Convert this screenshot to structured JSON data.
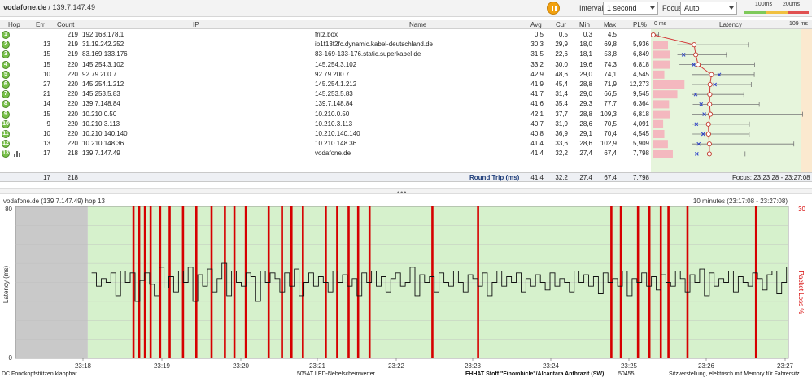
{
  "window": {
    "host": "vodafone.de",
    "ip_suffix": " / 139.7.147.49"
  },
  "toolbar": {
    "interval_label": "Interval",
    "interval_value": "1 second",
    "focus_label": "Focus",
    "focus_value": "Auto",
    "scale_100": "100ms",
    "scale_200": "200ms",
    "scale_colors": [
      "#7ec95a",
      "#f0c040",
      "#e05050"
    ]
  },
  "table": {
    "headers": {
      "hop": "Hop",
      "err": "Err",
      "count": "Count",
      "ip": "IP",
      "name": "Name",
      "avg": "Avg",
      "cur": "Cur",
      "min": "Min",
      "max": "Max",
      "pl": "PL%",
      "latency": "Latency",
      "lat_min": "0 ms",
      "lat_max": "109 ms"
    },
    "rows": [
      {
        "hop": "1",
        "err": "",
        "count": "219",
        "ip": "192.168.178.1",
        "name": "fritz.box",
        "avg": "0,5",
        "cur": "0,5",
        "min": "0,3",
        "max": "4,5",
        "pl": ""
      },
      {
        "hop": "2",
        "err": "13",
        "count": "219",
        "ip": "31.19.242.252",
        "name": "ip1f13f2fc.dynamic.kabel-deutschland.de",
        "avg": "30,3",
        "cur": "29,9",
        "min": "18,0",
        "max": "69,8",
        "pl": "5,936"
      },
      {
        "hop": "3",
        "err": "15",
        "count": "219",
        "ip": "83.169.133.176",
        "name": "83-169-133-176.static.superkabel.de",
        "avg": "31,5",
        "cur": "22,6",
        "min": "18,1",
        "max": "53,8",
        "pl": "6,849"
      },
      {
        "hop": "4",
        "err": "15",
        "count": "220",
        "ip": "145.254.3.102",
        "name": "145.254.3.102",
        "avg": "33,2",
        "cur": "30,0",
        "min": "19,6",
        "max": "74,3",
        "pl": "6,818"
      },
      {
        "hop": "5",
        "err": "10",
        "count": "220",
        "ip": "92.79.200.7",
        "name": "92.79.200.7",
        "avg": "42,9",
        "cur": "48,6",
        "min": "29,0",
        "max": "74,1",
        "pl": "4,545"
      },
      {
        "hop": "6",
        "err": "27",
        "count": "220",
        "ip": "145.254.1.212",
        "name": "145.254.1.212",
        "avg": "41,9",
        "cur": "45,4",
        "min": "28,8",
        "max": "71,9",
        "pl": "12,273"
      },
      {
        "hop": "7",
        "err": "21",
        "count": "220",
        "ip": "145.253.5.83",
        "name": "145.253.5.83",
        "avg": "41,7",
        "cur": "31,4",
        "min": "29,0",
        "max": "66,5",
        "pl": "9,545"
      },
      {
        "hop": "8",
        "err": "14",
        "count": "220",
        "ip": "139.7.148.84",
        "name": "139.7.148.84",
        "avg": "41,6",
        "cur": "35,4",
        "min": "29,3",
        "max": "77,7",
        "pl": "6,364"
      },
      {
        "hop": "9",
        "err": "15",
        "count": "220",
        "ip": "10.210.0.50",
        "name": "10.210.0.50",
        "avg": "42,1",
        "cur": "37,7",
        "min": "28,8",
        "max": "109,3",
        "pl": "6,818"
      },
      {
        "hop": "10",
        "err": "9",
        "count": "220",
        "ip": "10.210.3.113",
        "name": "10.210.3.113",
        "avg": "40,7",
        "cur": "31,9",
        "min": "28,6",
        "max": "70,5",
        "pl": "4,091"
      },
      {
        "hop": "11",
        "err": "10",
        "count": "220",
        "ip": "10.210.140.140",
        "name": "10.210.140.140",
        "avg": "40,8",
        "cur": "36,9",
        "min": "29,1",
        "max": "70,4",
        "pl": "4,545"
      },
      {
        "hop": "12",
        "err": "13",
        "count": "220",
        "ip": "10.210.148.36",
        "name": "10.210.148.36",
        "avg": "41,4",
        "cur": "33,6",
        "min": "28,6",
        "max": "102,9",
        "pl": "5,909"
      },
      {
        "hop": "13",
        "err": "17",
        "count": "218",
        "ip": "139.7.147.49",
        "name": "vodafone.de",
        "avg": "41,4",
        "cur": "32,2",
        "min": "27,4",
        "max": "67,4",
        "pl": "7,798"
      }
    ],
    "summary": {
      "err": "17",
      "count": "218",
      "label": "Round Trip (ms)",
      "avg": "41,4",
      "cur": "32,2",
      "min": "27,4",
      "max": "67,4",
      "pl": "7,798",
      "focus": "Focus: 23:23:28 - 23:27:08"
    }
  },
  "chart": {
    "title": "vodafone.de (139.7.147.49) hop 13",
    "range": "10 minutes (23:17:08 - 23:27:08)",
    "ylabel": "Latency (ms)",
    "y2label": "Packet Loss %",
    "y_ticks": [
      "0",
      "80"
    ],
    "y2_ticks": [
      "30"
    ],
    "x_ticks": [
      "23:18",
      "23:19",
      "23:20",
      "23:21",
      "23:22",
      "23:23",
      "23:24",
      "23:25",
      "23:26",
      "23:27"
    ],
    "colors": {
      "bg_gray": "#c9c9c9",
      "bg_green": "#d6f1cc",
      "loss": "#d60000",
      "line": "#111111"
    }
  },
  "chart_data": {
    "type": "line",
    "xlabel": "",
    "ylabel": "Latency (ms)",
    "ylim": [
      0,
      80
    ],
    "loss_marks_minutes": [
      23.79,
      23.82,
      23.85,
      23.88,
      23.93,
      23.98,
      24.05,
      24.12,
      24.2,
      24.27,
      24.32,
      24.38,
      24.5,
      24.57,
      24.62,
      24.68,
      24.8,
      24.86,
      24.92,
      24.97,
      25.03,
      25.36,
      25.6,
      26.3,
      26.35,
      26.44,
      26.5,
      26.56,
      26.6,
      26.7,
      27.06
    ],
    "latency_ms": [
      45,
      38,
      42,
      40,
      45,
      33,
      46,
      40,
      45,
      30,
      41,
      45,
      39,
      33,
      48,
      37,
      43,
      35,
      46,
      40,
      48,
      30,
      44,
      38,
      47,
      35,
      42,
      50,
      33,
      46,
      40,
      38,
      45,
      43,
      30,
      46,
      40,
      45,
      42,
      35,
      45,
      38,
      47,
      33,
      40,
      45,
      38,
      43,
      40,
      35,
      46,
      40,
      44,
      38,
      42,
      33,
      45,
      40,
      46,
      38,
      43,
      35,
      42,
      45,
      38,
      40,
      48,
      33,
      44,
      40,
      43,
      35,
      45,
      40,
      38,
      46,
      40,
      35,
      44,
      42,
      38,
      45,
      33,
      40,
      46,
      38,
      43,
      40,
      45,
      35,
      42,
      38,
      44,
      40,
      36,
      45,
      38,
      42,
      40,
      35,
      46,
      40,
      44,
      38,
      43,
      34,
      45,
      40,
      42,
      38,
      46,
      33,
      42,
      40,
      45,
      38,
      43,
      36,
      44,
      40,
      38,
      46,
      42,
      35,
      44,
      40,
      47,
      33,
      45,
      38,
      42,
      40,
      46,
      35,
      43,
      40,
      38,
      45,
      42,
      36,
      44,
      46,
      34,
      40,
      48
    ]
  },
  "bottom_strip": [
    "DC  Fondkopfstützen klappbar",
    "505AT LED-Nebelscheinwerfer",
    "FHHAT  Stoff \"Finombicle\"/Alcantara Anthrazit (SW)",
    "50455",
    "Sitzverstellung, elektrisch mit Memory für Fahrersitz"
  ]
}
